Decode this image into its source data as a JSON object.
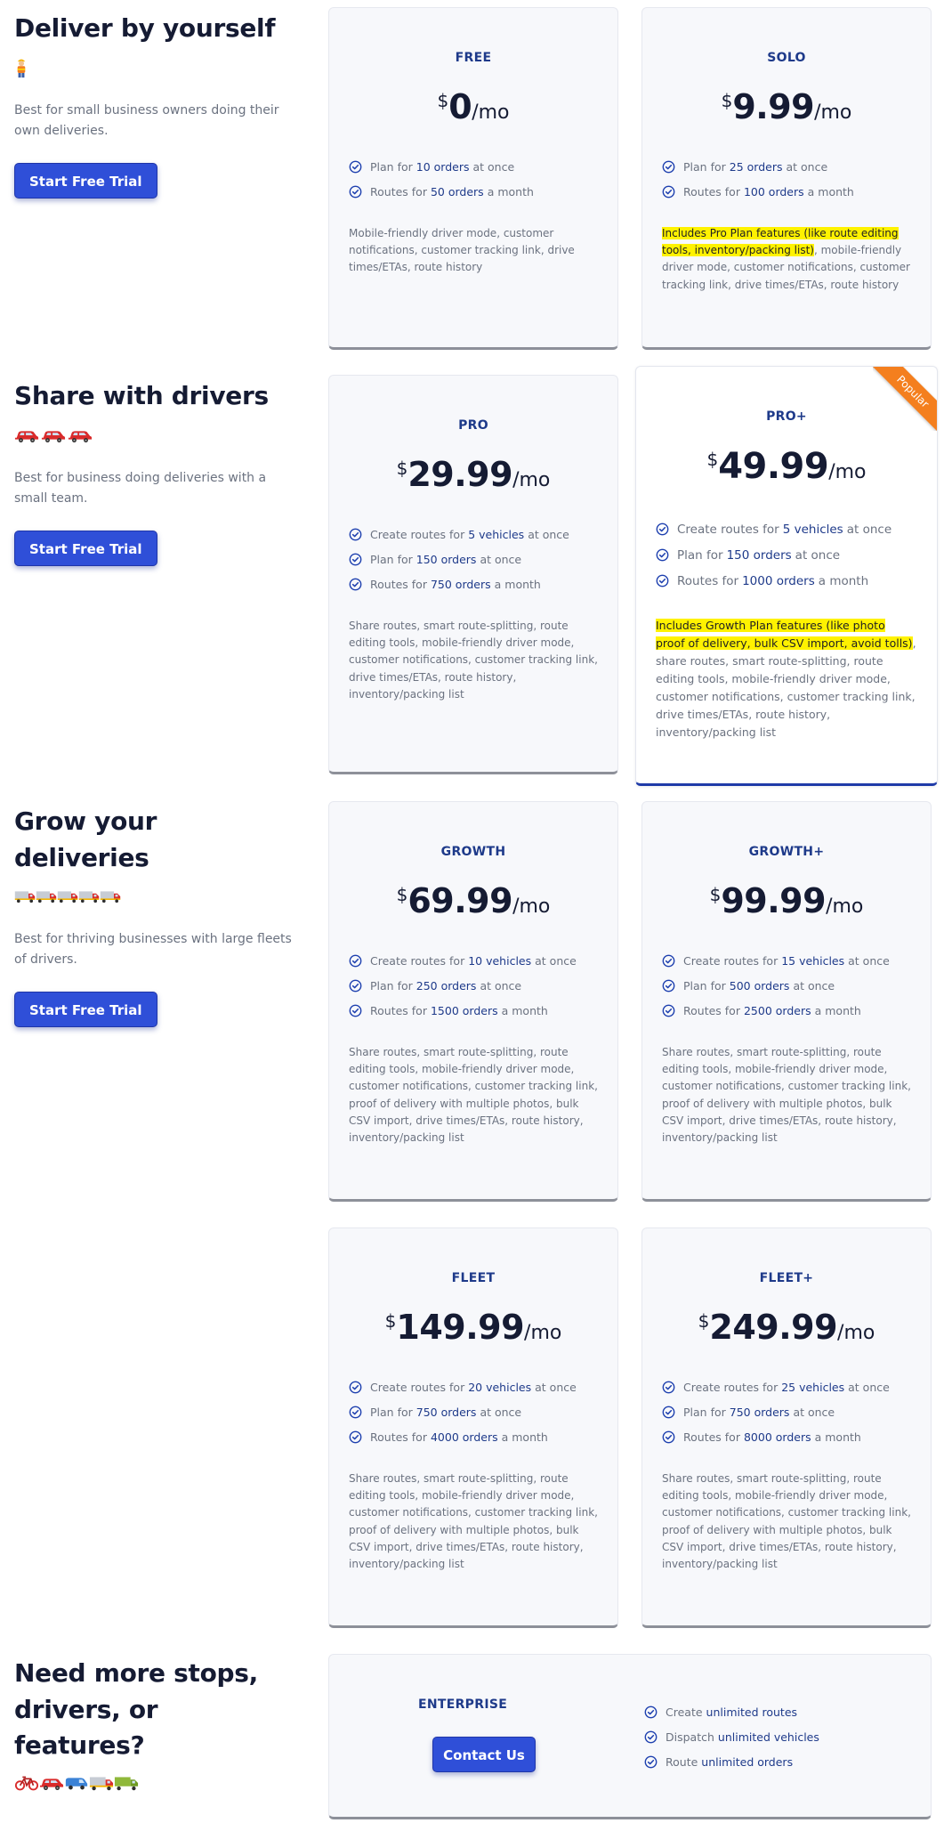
{
  "sections": [
    {
      "title": "Deliver by yourself",
      "description": "Best for small business owners doing their own deliveries.",
      "button": "Start Free Trial"
    },
    {
      "title": "Share with drivers",
      "description": "Best for business doing deliveries with a small team.",
      "button": "Start Free Trial"
    },
    {
      "title": "Grow your deliveries",
      "description": "Best for thriving businesses with large fleets of drivers.",
      "button": "Start Free Trial"
    },
    {
      "title": "Need more stops, drivers, or features?"
    }
  ],
  "plans": {
    "free": {
      "name": "FREE",
      "currency": "$",
      "amount": "0",
      "per": "/mo",
      "f1": {
        "pre": "Plan for",
        "hl": "10 orders",
        "post": "at once"
      },
      "f2": {
        "pre": "Routes for",
        "hl": "50 orders",
        "post": "a month"
      },
      "desc": "Mobile-friendly driver mode, customer notifications, customer tracking link, drive times/ETAs, route history"
    },
    "solo": {
      "name": "SOLO",
      "currency": "$",
      "amount": "9.99",
      "per": "/mo",
      "f1": {
        "pre": "Plan for",
        "hl": "25 orders",
        "post": "at once"
      },
      "f2": {
        "pre": "Routes for",
        "hl": "100 orders",
        "post": "a month"
      },
      "highlight": "Includes Pro Plan features (like route editing tools, inventory/packing list)",
      "desc": ", mobile-friendly driver mode, customer notifications, customer tracking link, drive times/ETAs, route history"
    },
    "pro": {
      "name": "PRO",
      "currency": "$",
      "amount": "29.99",
      "per": "/mo",
      "f1": {
        "pre": "Create routes for",
        "hl": "5 vehicles",
        "post": "at once"
      },
      "f2": {
        "pre": "Plan for",
        "hl": "150 orders",
        "post": "at once"
      },
      "f3": {
        "pre": "Routes for",
        "hl": "750 orders",
        "post": "a month"
      },
      "desc": "Share routes, smart route-splitting, route editing tools, mobile-friendly driver mode, customer notifications, customer tracking link, drive times/ETAs, route history, inventory/packing list"
    },
    "proplus": {
      "name": "PRO+",
      "ribbon": "Popular",
      "currency": "$",
      "amount": "49.99",
      "per": "/mo",
      "f1": {
        "pre": "Create routes for",
        "hl": "5 vehicles",
        "post": "at once"
      },
      "f2": {
        "pre": "Plan for",
        "hl": "150 orders",
        "post": "at once"
      },
      "f3": {
        "pre": "Routes for",
        "hl": "1000 orders",
        "post": "a month"
      },
      "highlight": "Includes Growth Plan features (like photo proof of delivery, bulk CSV import, avoid tolls)",
      "desc": ", share routes, smart route-splitting, route editing tools, mobile-friendly driver mode, customer notifications, customer tracking link, drive times/ETAs, route history, inventory/packing list"
    },
    "growth": {
      "name": "GROWTH",
      "currency": "$",
      "amount": "69.99",
      "per": "/mo",
      "f1": {
        "pre": "Create routes for",
        "hl": "10 vehicles",
        "post": "at once"
      },
      "f2": {
        "pre": "Plan for",
        "hl": "250 orders",
        "post": "at once"
      },
      "f3": {
        "pre": "Routes for",
        "hl": "1500 orders",
        "post": "a month"
      },
      "desc": "Share routes, smart route-splitting, route editing tools, mobile-friendly driver mode, customer notifications, customer tracking link, proof of delivery with multiple photos, bulk CSV import, drive times/ETAs, route history, inventory/packing list"
    },
    "growthplus": {
      "name": "GROWTH+",
      "currency": "$",
      "amount": "99.99",
      "per": "/mo",
      "f1": {
        "pre": "Create routes for",
        "hl": "15 vehicles",
        "post": "at once"
      },
      "f2": {
        "pre": "Plan for",
        "hl": "500 orders",
        "post": "at once"
      },
      "f3": {
        "pre": "Routes for",
        "hl": "2500 orders",
        "post": "a month"
      },
      "desc": "Share routes, smart route-splitting, route editing tools, mobile-friendly driver mode, customer notifications, customer tracking link, proof of delivery with multiple photos, bulk CSV import, drive times/ETAs, route history, inventory/packing list"
    },
    "fleet": {
      "name": "FLEET",
      "currency": "$",
      "amount": "149.99",
      "per": "/mo",
      "f1": {
        "pre": "Create routes for",
        "hl": "20 vehicles",
        "post": "at once"
      },
      "f2": {
        "pre": "Plan for",
        "hl": "750 orders",
        "post": "at once"
      },
      "f3": {
        "pre": "Routes for",
        "hl": "4000 orders",
        "post": "a month"
      },
      "desc": "Share routes, smart route-splitting, route editing tools, mobile-friendly driver mode, customer notifications, customer tracking link, proof of delivery with multiple photos, bulk CSV import, drive times/ETAs, route history, inventory/packing list"
    },
    "fleetplus": {
      "name": "FLEET+",
      "currency": "$",
      "amount": "249.99",
      "per": "/mo",
      "f1": {
        "pre": "Create routes for",
        "hl": "25 vehicles",
        "post": "at once"
      },
      "f2": {
        "pre": "Plan for",
        "hl": "750 orders",
        "post": "at once"
      },
      "f3": {
        "pre": "Routes for",
        "hl": "8000 orders",
        "post": "a month"
      },
      "desc": "Share routes, smart route-splitting, route editing tools, mobile-friendly driver mode, customer notifications, customer tracking link, proof of delivery with multiple photos, bulk CSV import, drive times/ETAs, route history, inventory/packing list"
    },
    "enterprise": {
      "name": "ENTERPRISE",
      "button": "Contact Us",
      "f1": {
        "pre": "Create",
        "hl": "unlimited routes",
        "post": ""
      },
      "f2": {
        "pre": "Dispatch",
        "hl": "unlimited vehicles",
        "post": ""
      },
      "f3": {
        "pre": "Route",
        "hl": "unlimited orders",
        "post": ""
      }
    }
  },
  "icons": {
    "check": "check-circle-icon",
    "worker": "construction-worker-icon",
    "car": "red-car-icon",
    "truck": "delivery-truck-icon",
    "bicycle": "bicycle-icon",
    "van": "blue-van-icon",
    "lorry": "green-lorry-icon"
  },
  "colors": {
    "accent": "#2f4fd8",
    "plan_name": "#1e3a8a",
    "highlight": "#fff200",
    "ribbon": "#f47f1e"
  }
}
